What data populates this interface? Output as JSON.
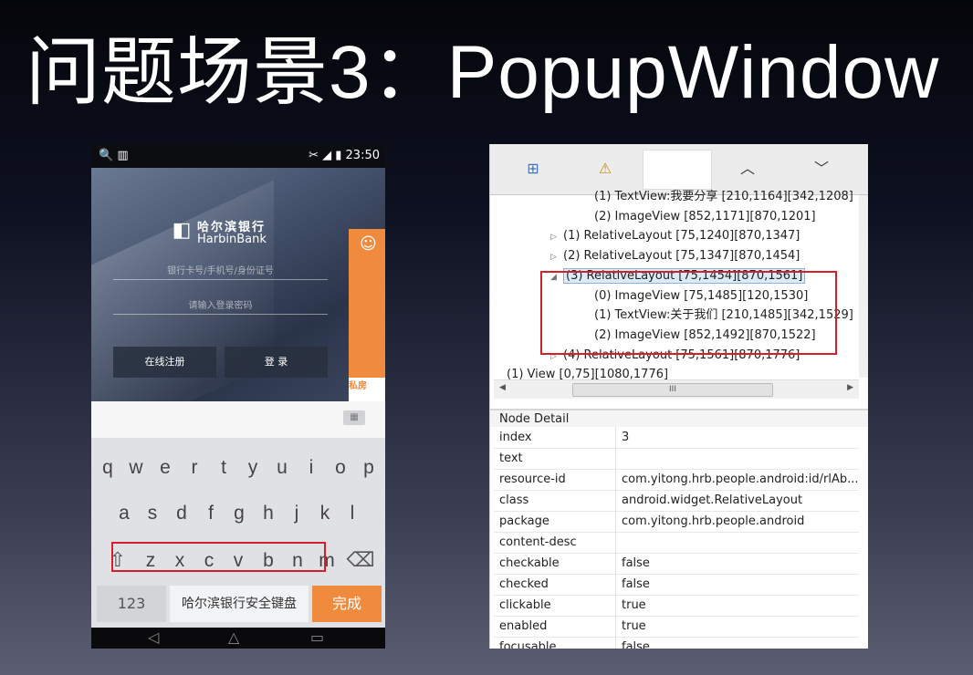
{
  "title": "问题场景3：PopupWindow",
  "phone": {
    "statusbar": {
      "left_icons": "🔍 ▥",
      "right_icons": "✂ ◢ ▮",
      "time": "23:50"
    },
    "logo_cn": "哈尔滨银行",
    "logo_en": "HarbinBank",
    "card_placeholder": "银行卡号/手机号/身份证号",
    "password_placeholder": "请输入登录密码",
    "register_button": "在线注册",
    "login_button": "登 录",
    "orange_text": "私房",
    "keyboard": {
      "row1": [
        "q",
        "w",
        "e",
        "r",
        "t",
        "y",
        "u",
        "i",
        "o",
        "p"
      ],
      "row2": [
        "a",
        "s",
        "d",
        "f",
        "g",
        "h",
        "j",
        "k",
        "l"
      ],
      "row3": [
        "z",
        "x",
        "c",
        "v",
        "b",
        "n",
        "m"
      ],
      "numbers_key": "123",
      "space_key": "哈尔滨银行安全键盘",
      "done_key": "完成",
      "shift_glyph": "⇧",
      "delete_glyph": "⌫"
    }
  },
  "tools": {
    "toolbar_glyphs": {
      "expand": "⊞",
      "warning": "⚠",
      "up": "︿",
      "down": "﹀"
    },
    "tree": [
      {
        "indent": 96,
        "arrow": "",
        "text": "(1) TextView:我要分享 [210,1164][342,1208]"
      },
      {
        "indent": 96,
        "arrow": "",
        "text": "(2) ImageView [852,1171][870,1201]"
      },
      {
        "indent": 62,
        "arrow": "▷",
        "text": "(1) RelativeLayout [75,1240][870,1347]"
      },
      {
        "indent": 62,
        "arrow": "▷",
        "text": "(2) RelativeLayout [75,1347][870,1454]"
      },
      {
        "indent": 62,
        "arrow": "◢",
        "text": "(3) RelativeLayout [75,1454][870,1561]",
        "selected": true
      },
      {
        "indent": 96,
        "arrow": "",
        "text": "(0) ImageView [75,1485][120,1530]"
      },
      {
        "indent": 96,
        "arrow": "",
        "text": "(1) TextView:关于我们 [210,1485][342,1529]"
      },
      {
        "indent": 96,
        "arrow": "",
        "text": "(2) ImageView [852,1492][870,1522]"
      },
      {
        "indent": 62,
        "arrow": "▷",
        "text": "(4) RelativeLayout [75,1561][870,1776]"
      },
      {
        "indent": 0,
        "arrow": "",
        "text": "(1) View [0,75][1080,1776]"
      }
    ],
    "scroll_thumb_label": "III",
    "detail_title": "Node Detail",
    "details": [
      {
        "key": "index",
        "value": "3"
      },
      {
        "key": "text",
        "value": ""
      },
      {
        "key": "resource-id",
        "value": "com.yitong.hrb.people.android:id/rlAb..."
      },
      {
        "key": "class",
        "value": "android.widget.RelativeLayout"
      },
      {
        "key": "package",
        "value": "com.yitong.hrb.people.android"
      },
      {
        "key": "content-desc",
        "value": ""
      },
      {
        "key": "checkable",
        "value": "false"
      },
      {
        "key": "checked",
        "value": "false"
      },
      {
        "key": "clickable",
        "value": "true"
      },
      {
        "key": "enabled",
        "value": "true"
      },
      {
        "key": "focusable",
        "value": "false"
      }
    ]
  },
  "colors": {
    "accent": "#f08a3c",
    "highlight": "#d4202a",
    "selection": "#dcebf9"
  }
}
